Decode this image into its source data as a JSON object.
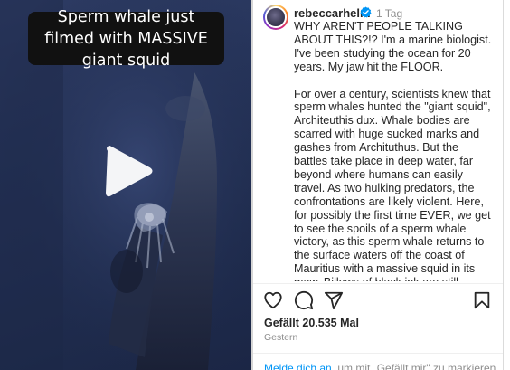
{
  "video": {
    "overlay_title": "Sperm whale just filmed with MASSIVE giant squid",
    "play_icon": "play-icon"
  },
  "post": {
    "username": "rebeccarhelm",
    "verified_icon": "verified-badge-icon",
    "timestamp": "1 Tag",
    "caption_paragraphs": [
      "WHY AREN'T PEOPLE TALKING ABOUT THIS?!? I'm a marine biologist. I've been studying the ocean for 20 years. My jaw hit the FLOOR.",
      "For over a century, scientists knew that sperm whales hunted the \"giant squid\", Architeuthis dux. Whale bodies are scarred with huge sucked marks and gashes from Archituthus. But the battles take place in deep water, far beyond where humans can easily travel. As two hulking predators, the confrontations are likely violent. Here, for possibly the first time EVER, we get to see the spoils of a sperm whale victory, as this sperm whale returns to the surface waters off the coast of Mauritius with a massive squid in its maw. Billows of black ink are still flowing, a last battle cry from the battered squid."
    ],
    "likes": "Gefällt 20.535 Mal",
    "date": "Gestern",
    "login_link": "Melde dich an",
    "login_rest": ", um mit „Gefällt mir\" zu markieren"
  },
  "actions": {
    "like_icon": "heart-icon",
    "comment_icon": "comment-icon",
    "share_icon": "share-icon",
    "save_icon": "bookmark-icon"
  },
  "colors": {
    "accent_link": "#0095f6",
    "text_primary": "#262626",
    "text_secondary": "#8e8e8e",
    "verified_blue": "#0095f6",
    "video_bg": "#26345a"
  }
}
